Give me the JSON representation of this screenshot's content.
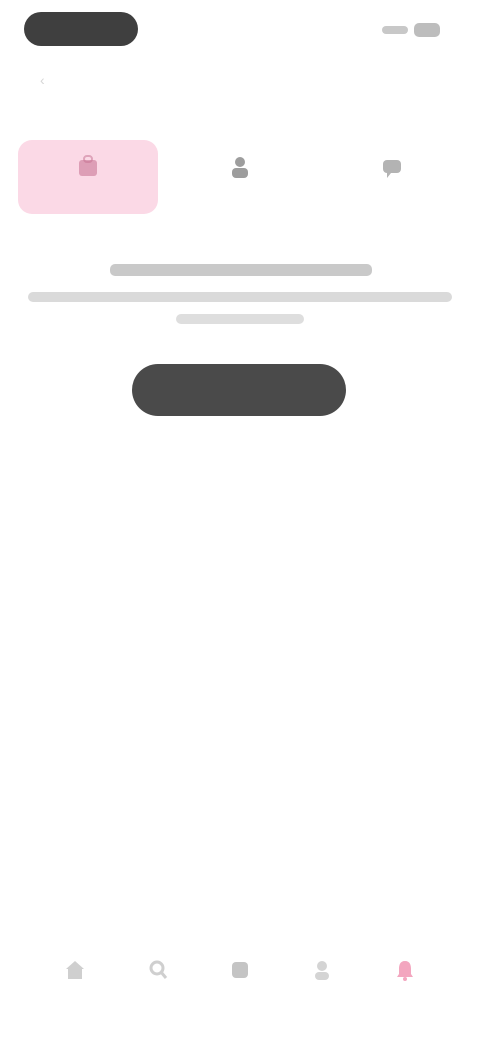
{
  "header": {
    "pill_label": "",
    "back_glyph": "‹"
  },
  "tabs": [
    {
      "label": "",
      "icon": "bag-icon",
      "active": true
    },
    {
      "label": "",
      "icon": "person-icon",
      "active": false
    },
    {
      "label": "",
      "icon": "chat-icon",
      "active": false
    }
  ],
  "empty_state": {
    "title": "",
    "body": "",
    "cta_label": ""
  },
  "bottom_nav": [
    {
      "label": "",
      "icon": "home-icon"
    },
    {
      "label": "",
      "icon": "search-icon"
    },
    {
      "label": "",
      "icon": "add-icon"
    },
    {
      "label": "",
      "icon": "profile-icon"
    },
    {
      "label": "",
      "icon": "notifications-icon"
    }
  ],
  "colors": {
    "accent": "#f26d99",
    "active_tab_bg": "#fbd9e6",
    "button": "#4a4a4a"
  }
}
